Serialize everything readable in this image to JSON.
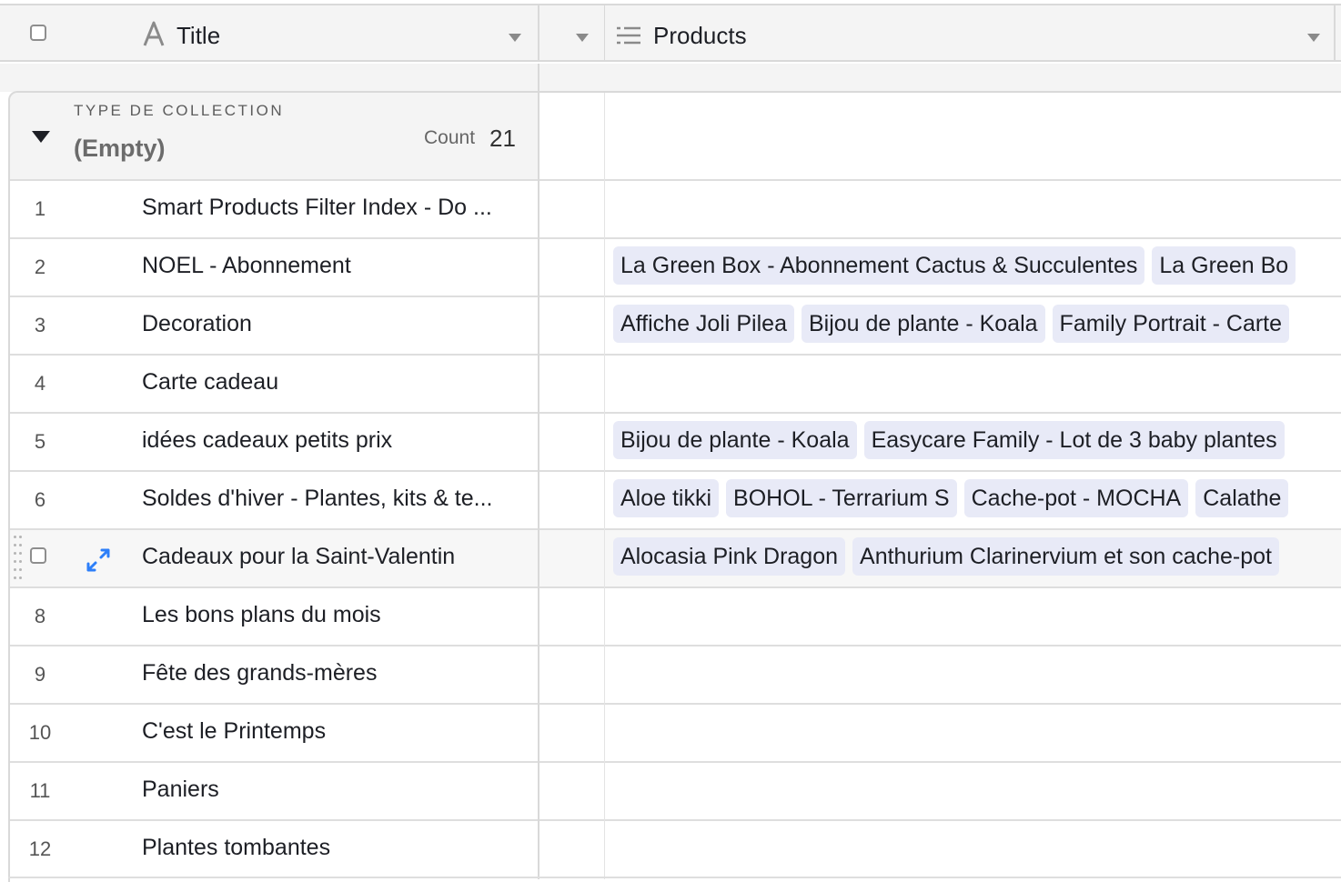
{
  "header": {
    "title_label": "Title",
    "products_label": "Products"
  },
  "group": {
    "label": "TYPE DE COLLECTION",
    "value": "(Empty)",
    "count_label": "Count",
    "count_value": "21"
  },
  "rows": [
    {
      "num": "1",
      "title": "Smart Products Filter Index - Do ...",
      "products": []
    },
    {
      "num": "2",
      "title": "NOEL - Abonnement",
      "products": [
        "La Green Box - Abonnement Cactus & Succulentes",
        "La Green Bo"
      ]
    },
    {
      "num": "3",
      "title": "Decoration",
      "products": [
        "Affiche Joli Pilea",
        "Bijou de plante - Koala",
        "Family Portrait - Carte"
      ]
    },
    {
      "num": "4",
      "title": "Carte cadeau",
      "products": []
    },
    {
      "num": "5",
      "title": "idées cadeaux petits prix",
      "products": [
        "Bijou de plante - Koala",
        "Easycare Family - Lot de 3 baby plantes"
      ]
    },
    {
      "num": "6",
      "title": "Soldes d'hiver - Plantes, kits & te...",
      "products": [
        "Aloe tikki",
        "BOHOL - Terrarium S",
        "Cache-pot - MOCHA",
        "Calathe"
      ]
    },
    {
      "num": "",
      "title": "Cadeaux pour la Saint-Valentin",
      "products": [
        "Alocasia Pink Dragon",
        "Anthurium Clarinervium et son cache-pot"
      ],
      "hover": true
    },
    {
      "num": "8",
      "title": "Les bons plans du mois",
      "products": []
    },
    {
      "num": "9",
      "title": "Fête des grands-mères",
      "products": []
    },
    {
      "num": "10",
      "title": "C'est le Printemps",
      "products": []
    },
    {
      "num": "11",
      "title": "Paniers",
      "products": []
    },
    {
      "num": "12",
      "title": "Plantes tombantes",
      "products": []
    }
  ],
  "colors": {
    "chip_bg": "#e8eaf7",
    "expand_icon": "#2d7ff9"
  }
}
